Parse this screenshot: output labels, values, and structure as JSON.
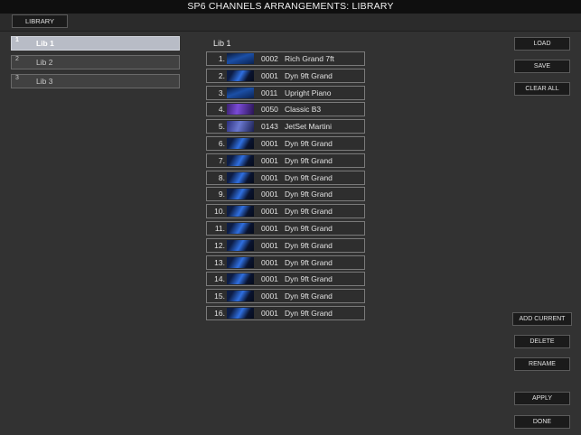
{
  "title": "SP6 CHANNELS ARRANGEMENTS: LIBRARY",
  "toolbar": {
    "library_label": "LIBRARY"
  },
  "libraries": [
    {
      "num": "1",
      "label": "Lib 1",
      "active": true
    },
    {
      "num": "2",
      "label": "Lib 2",
      "active": false
    },
    {
      "num": "3",
      "label": "Lib 3",
      "active": false
    }
  ],
  "current_library": "Lib 1",
  "slots": [
    {
      "num": "1.",
      "code": "0002",
      "name": "Rich Grand 7ft",
      "thumb": "piano-thumbnail"
    },
    {
      "num": "2.",
      "code": "0001",
      "name": "Dyn 9ft Grand",
      "thumb": "grand-thumbnail"
    },
    {
      "num": "3.",
      "code": "0011",
      "name": "Upright Piano",
      "thumb": "piano-thumbnail"
    },
    {
      "num": "4.",
      "code": "0050",
      "name": "Classic B3",
      "thumb": "organ-thumbnail"
    },
    {
      "num": "5.",
      "code": "0143",
      "name": "JetSet Martini",
      "thumb": "epiano-thumbnail"
    },
    {
      "num": "6.",
      "code": "0001",
      "name": "Dyn 9ft Grand",
      "thumb": "grand-thumbnail"
    },
    {
      "num": "7.",
      "code": "0001",
      "name": "Dyn 9ft Grand",
      "thumb": "grand-thumbnail"
    },
    {
      "num": "8.",
      "code": "0001",
      "name": "Dyn 9ft Grand",
      "thumb": "grand-thumbnail"
    },
    {
      "num": "9.",
      "code": "0001",
      "name": "Dyn 9ft Grand",
      "thumb": "grand-thumbnail"
    },
    {
      "num": "10.",
      "code": "0001",
      "name": "Dyn 9ft Grand",
      "thumb": "grand-thumbnail"
    },
    {
      "num": "11.",
      "code": "0001",
      "name": "Dyn 9ft Grand",
      "thumb": "grand-thumbnail"
    },
    {
      "num": "12.",
      "code": "0001",
      "name": "Dyn 9ft Grand",
      "thumb": "grand-thumbnail"
    },
    {
      "num": "13.",
      "code": "0001",
      "name": "Dyn 9ft Grand",
      "thumb": "grand-thumbnail"
    },
    {
      "num": "14.",
      "code": "0001",
      "name": "Dyn 9ft Grand",
      "thumb": "grand-thumbnail"
    },
    {
      "num": "15.",
      "code": "0001",
      "name": "Dyn 9ft Grand",
      "thumb": "grand-thumbnail"
    },
    {
      "num": "16.",
      "code": "0001",
      "name": "Dyn 9ft Grand",
      "thumb": "grand-thumbnail"
    }
  ],
  "actions": {
    "load": "LOAD",
    "save": "SAVE",
    "clear_all": "CLEAR ALL",
    "add_current": "ADD CURRENT",
    "delete": "DELETE",
    "rename": "RENAME",
    "apply": "APPLY",
    "done": "DONE"
  },
  "colors": {
    "background": "#323232",
    "titlebar": "#0f0f0f",
    "button": "#1b1b1b",
    "active_library": "#b8bcc6"
  }
}
